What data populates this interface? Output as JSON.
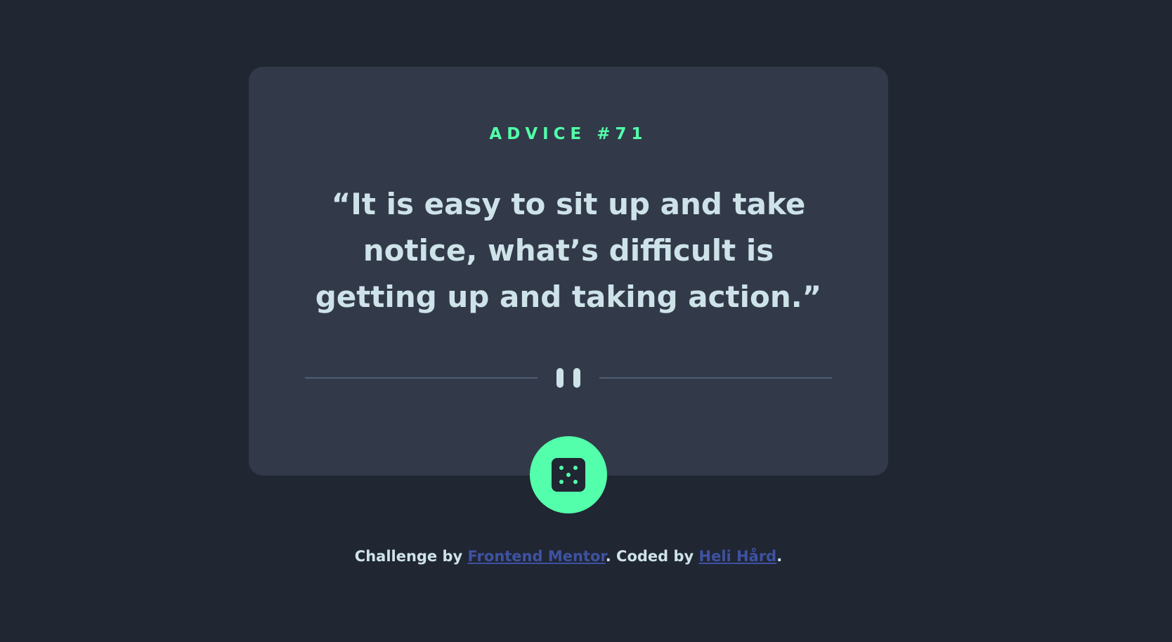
{
  "advice": {
    "id_label": "ADVICE #71",
    "quote": "“It is easy to sit up and take notice, what’s difficult is getting up and taking action.”"
  },
  "divider": {
    "icon": "pause-icon"
  },
  "dice_button": {
    "icon": "dice-icon"
  },
  "footer": {
    "prefix": "Challenge by ",
    "link1_text": "Frontend Mentor",
    "middle": ". Coded by ",
    "link2_text": "Heli Hård",
    "suffix": "."
  },
  "colors": {
    "background": "#202632",
    "card": "#323a49",
    "accent": "#53ffaa",
    "text": "#cee3e9",
    "divider": "#4f5d74",
    "link": "#3e52a3"
  }
}
